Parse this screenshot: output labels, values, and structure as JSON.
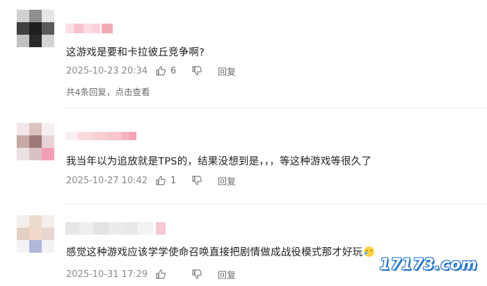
{
  "comments": [
    {
      "text": "这游戏是要和卡拉彼丘竞争啊?",
      "time": "2025-10-23 20:34",
      "likes": "6",
      "reply_label": "回复",
      "more_replies": "共4条回复，点击查看"
    },
    {
      "text": "我当年以为追放就是TPS的，结果没想到是，，，等这种游戏等很久了",
      "time": "2025-10-27 10:42",
      "likes": "1",
      "reply_label": "回复"
    },
    {
      "text": "感觉这种游戏应该学学使命召唤直接把剧情做成战役模式那才好玩",
      "time": "2025-10-31 17:29",
      "likes": "0",
      "reply_label": "回复",
      "emoji": "crying-laughing-emoji"
    }
  ],
  "watermark": "17173.com",
  "colors": {
    "meta_text": "#8a8a8a",
    "divider": "#eeeeee",
    "watermark_outline": "#1a6fd0"
  }
}
